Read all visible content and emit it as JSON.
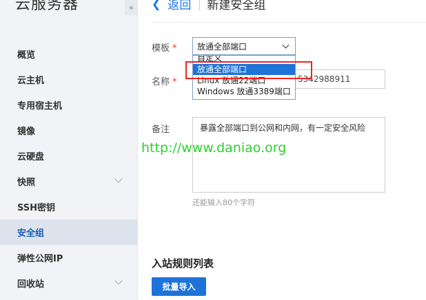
{
  "sidebar": {
    "title": "云服务器",
    "collapse_icon": "«",
    "items": [
      {
        "label": "概览",
        "has_chevron": false
      },
      {
        "label": "云主机",
        "has_chevron": false
      },
      {
        "label": "专用宿主机",
        "has_chevron": false
      },
      {
        "label": "镜像",
        "has_chevron": false
      },
      {
        "label": "云硬盘",
        "has_chevron": false
      },
      {
        "label": "快照",
        "has_chevron": true
      },
      {
        "label": "SSH密钥",
        "has_chevron": false
      },
      {
        "label": "安全组",
        "has_chevron": false,
        "active": true
      },
      {
        "label": "弹性公网IP",
        "has_chevron": false
      },
      {
        "label": "回收站",
        "has_chevron": true
      }
    ]
  },
  "header": {
    "back_label": "返回",
    "title": "新建安全组"
  },
  "form": {
    "template_label": "模板",
    "required_mark": "*",
    "template_selected": "放通全部端口",
    "template_options": [
      "自定义",
      "放通全部端口",
      "Linux 放通22端口",
      "Windows 放通3389端口"
    ],
    "name_label": "名称",
    "name_value": "5342988911",
    "note_label": "备注",
    "note_value": "暴露全部端口到公网和内网，有一定安全风险",
    "note_hint": "还能输入80个字符"
  },
  "watermark": "http://www.daniao.org",
  "rules": {
    "section_title": "入站规则列表",
    "import_button": "批量导入"
  },
  "colors": {
    "accent": "#1e73d8",
    "highlight": "#e22222",
    "watermark": "#2fcf2f",
    "sidebar_bg": "#f1f3f6"
  }
}
